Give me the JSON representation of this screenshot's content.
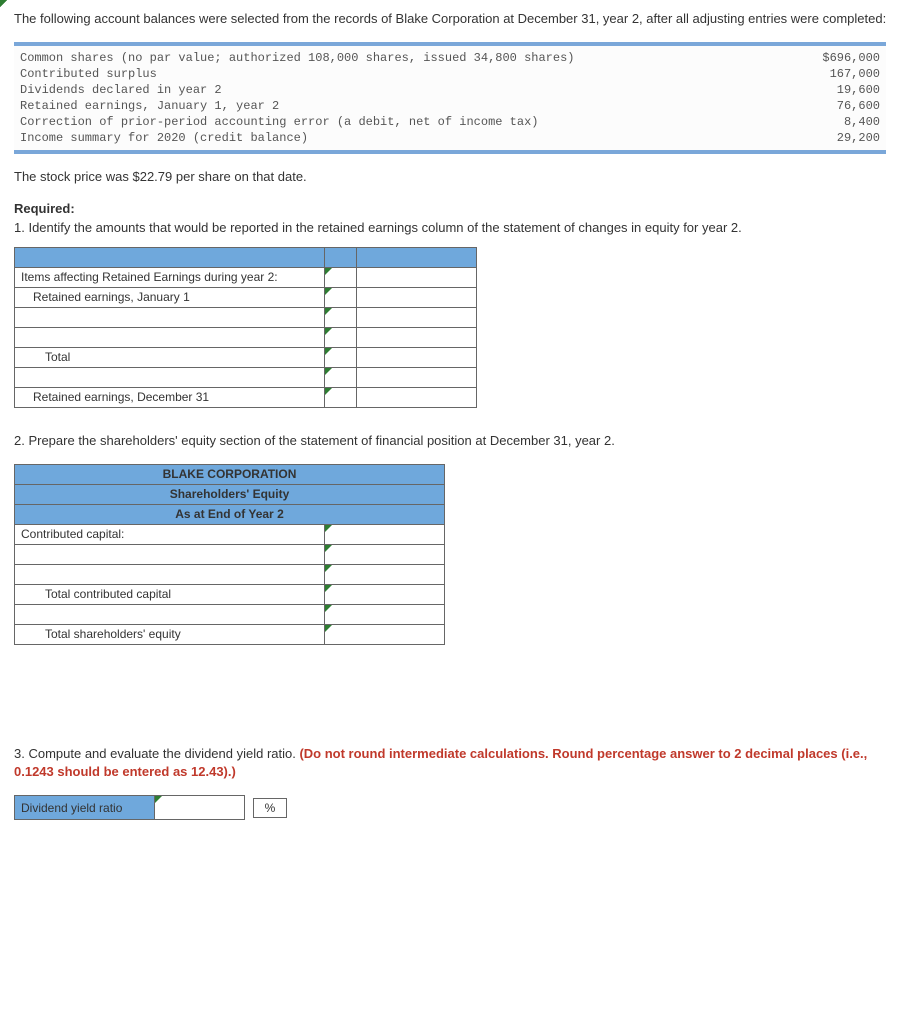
{
  "intro": "The following account balances were selected from the records of Blake Corporation at December 31, year 2, after all adjusting entries were completed:",
  "accounts": [
    {
      "label": "Common shares (no par value; authorized 108,000 shares, issued 34,800 shares)",
      "value": "$696,000"
    },
    {
      "label": "Contributed surplus",
      "value": "167,000"
    },
    {
      "label": "Dividends declared in year 2",
      "value": "19,600"
    },
    {
      "label": "Retained earnings, January 1, year 2",
      "value": "76,600"
    },
    {
      "label": "Correction of prior-period accounting error (a debit, net of income tax)",
      "value": "8,400"
    },
    {
      "label": "Income summary for 2020 (credit balance)",
      "value": "29,200"
    }
  ],
  "stock_price_line": "The stock price was $22.79 per share on that date.",
  "required_label": "Required:",
  "q1": "1. Identify the amounts that would be reported in the retained earnings column of the statement of changes in equity for year 2.",
  "t1": {
    "items_header": "Items affecting Retained Earnings during year 2:",
    "row_jan1": "Retained earnings, January 1",
    "row_total": "Total",
    "row_dec31": "Retained earnings, December 31"
  },
  "q2": "2. Prepare the shareholders' equity section of the statement of financial position at December 31, year 2.",
  "t2": {
    "h1": "BLAKE CORPORATION",
    "h2": "Shareholders' Equity",
    "h3": "As at End of Year 2",
    "contributed_capital": "Contributed capital:",
    "total_contributed": "Total contributed capital",
    "total_se": "Total shareholders' equity"
  },
  "q3_a": "3. Compute and evaluate the dividend yield ratio. ",
  "q3_b": "(Do not round intermediate calculations. Round percentage answer to 2 decimal places (i.e., 0.1243 should be entered as 12.43).)",
  "dy_label": "Dividend yield ratio",
  "pct": "%"
}
